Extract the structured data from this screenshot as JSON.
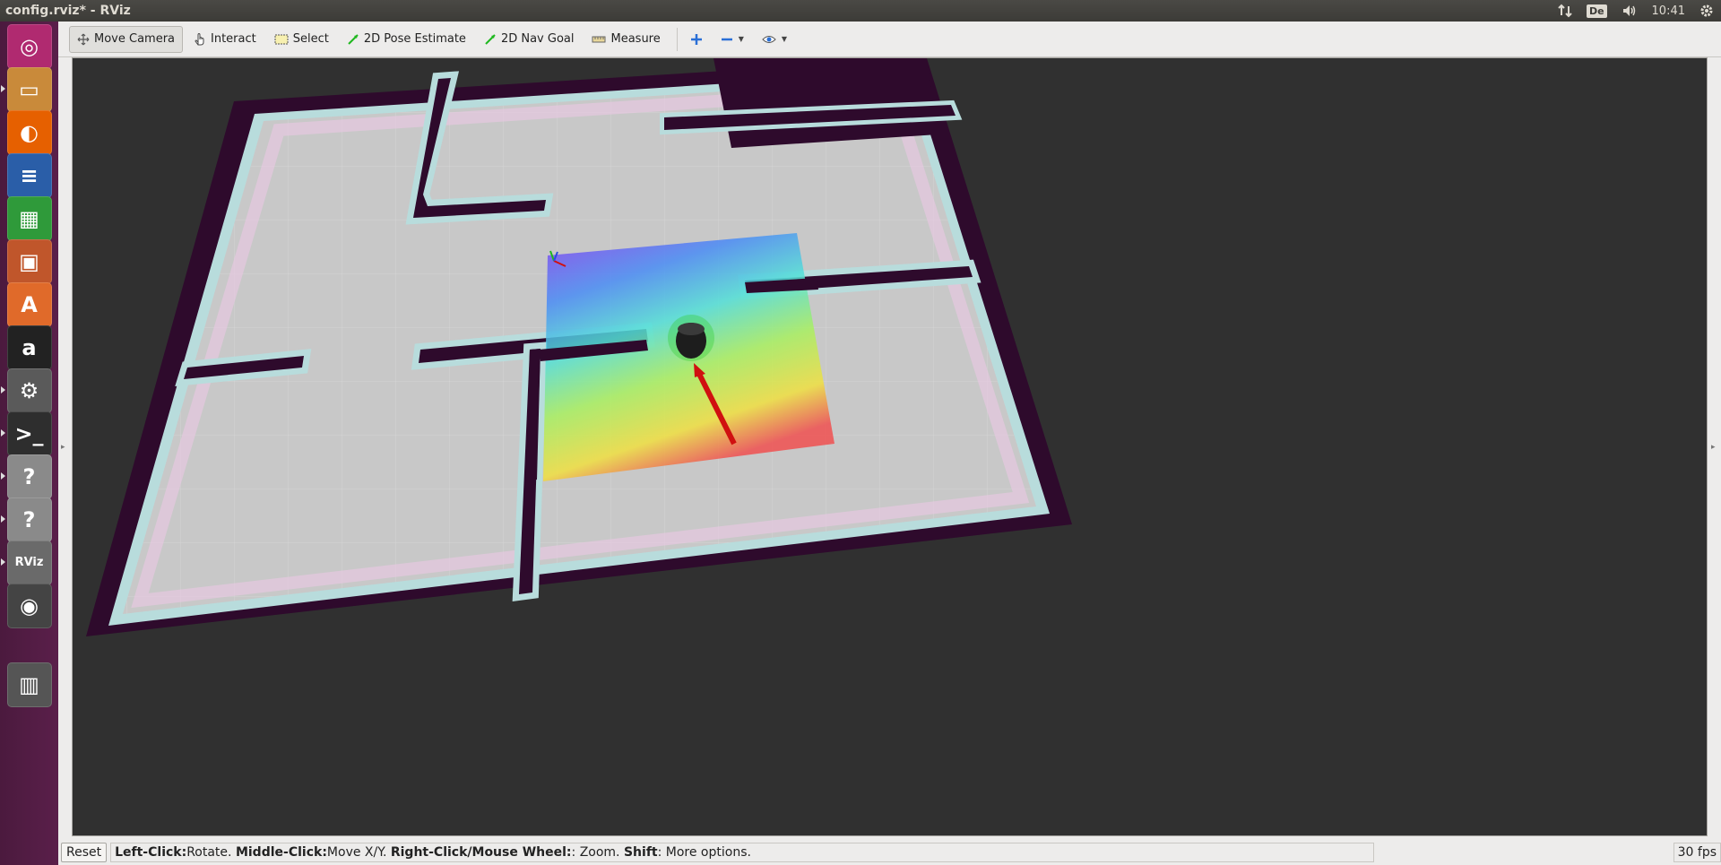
{
  "window": {
    "title": "config.rviz* - RViz"
  },
  "panel": {
    "keyboard": "De",
    "clock": "10:41"
  },
  "toolbar": {
    "move_camera": "Move Camera",
    "interact": "Interact",
    "select": "Select",
    "pose_estimate": "2D Pose Estimate",
    "nav_goal": "2D Nav Goal",
    "measure": "Measure"
  },
  "launcher": [
    {
      "name": "ubuntu-dash-icon",
      "color": "#b02a70"
    },
    {
      "name": "files-icon",
      "color": "#c98a3a"
    },
    {
      "name": "firefox-icon",
      "color": "#e66000"
    },
    {
      "name": "writer-icon",
      "color": "#2a5ea8"
    },
    {
      "name": "calc-icon",
      "color": "#2f9a3a"
    },
    {
      "name": "impress-icon",
      "color": "#c0562b"
    },
    {
      "name": "software-center-icon",
      "color": "#e06a2a"
    },
    {
      "name": "amazon-icon",
      "color": "#222222"
    },
    {
      "name": "system-settings-icon",
      "color": "#5a5a5a"
    },
    {
      "name": "terminal-icon",
      "color": "#2e2e2e"
    },
    {
      "name": "unknown-app-icon",
      "color": "#8a8a8a"
    },
    {
      "name": "unknown-app-icon",
      "color": "#8a8a8a"
    },
    {
      "name": "rviz-icon",
      "color": "#6a6a6a"
    },
    {
      "name": "dvd-icon",
      "color": "#444444"
    },
    {
      "name": "trash-icon",
      "color": "#555555"
    }
  ],
  "status": {
    "reset": "Reset",
    "k1": "Left-Click:",
    "v1": " Rotate. ",
    "k2": "Middle-Click:",
    "v2": " Move X/Y. ",
    "k3": "Right-Click/Mouse Wheel:",
    "v3": ": Zoom. ",
    "k4": "Shift",
    "v4": ": More options.",
    "fps": "30 fps"
  },
  "colors": {
    "map_wall": "#2e0a2c",
    "map_free": "#c8c8c8",
    "inflation": "#b9e0e0",
    "goal_arrow": "#d01010"
  }
}
